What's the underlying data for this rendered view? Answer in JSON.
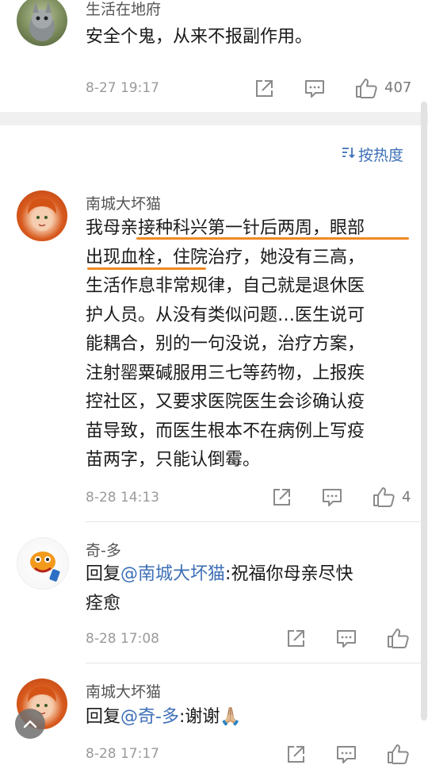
{
  "comments_top": {
    "username": "生活在地府",
    "text": "安全个鬼，从来不报副作用。",
    "time": "8-27 19:17",
    "likes": "407"
  },
  "sort": {
    "label": "按热度",
    "icon": "sort-icon"
  },
  "main_comment": {
    "username": "南城大坏猫",
    "lines": [
      "我母亲接种科兴第一针后两周，眼部",
      "出现血栓，住院治疗，她没有三高，",
      "生活作息非常规律，自己就是退休医",
      "护人员。从没有类似问题…医生说可",
      "能耦合，别的一句没说，治疗方案，",
      "注射罂粟碱服用三七等药物，上报疾",
      "控社区，又要求医院医生会诊确认疫",
      "苗导致，而医生根本不在病例上写疫",
      "苗两字，只能认倒霉。"
    ],
    "time": "8-28 14:13",
    "likes": "4",
    "highlight_color": "#f08a24"
  },
  "reply1": {
    "username": "奇-多",
    "prefix": "回复",
    "mention": "@南城大坏猫",
    "line1_rest": ":祝福你母亲尽快",
    "line2": "痊愈",
    "time": "8-28 17:08"
  },
  "reply2": {
    "username": "南城大坏猫",
    "prefix": "回复",
    "mention": "@奇-多",
    "rest": ":谢谢🙏🏼",
    "time": "8-28 17:17"
  },
  "icons": [
    "share-icon",
    "comment-icon",
    "like-icon",
    "chevron-up-icon"
  ],
  "colors": {
    "mention": "#3d6fb6",
    "sort": "#3d6fb6",
    "meta": "#9a9a9a"
  }
}
